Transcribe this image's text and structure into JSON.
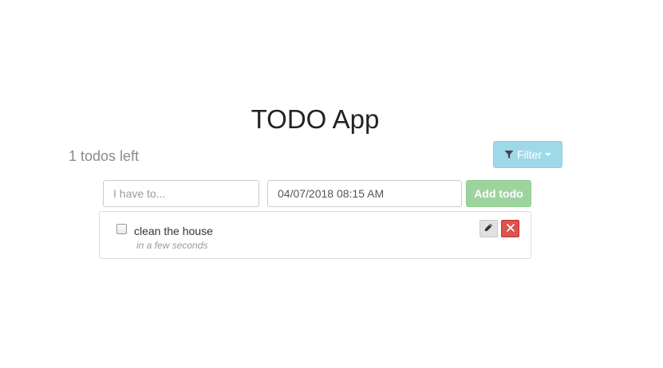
{
  "app": {
    "title": "TODO App",
    "todos_left": "1 todos left"
  },
  "filter": {
    "label": "Filter",
    "icon": "filter-icon",
    "caret_icon": "caret-down-icon",
    "color": "#9fd9e9"
  },
  "form": {
    "todo_placeholder": "I have to...",
    "todo_value": "",
    "date_value": "04/07/2018 08:15 AM",
    "add_label": "Add todo",
    "add_color": "#9dd49d"
  },
  "todos": [
    {
      "text": "clean the house",
      "time": "in a few seconds",
      "done": false,
      "edit_icon": "pencil-icon",
      "delete_icon": "close-icon",
      "delete_color": "#d9534f"
    }
  ]
}
